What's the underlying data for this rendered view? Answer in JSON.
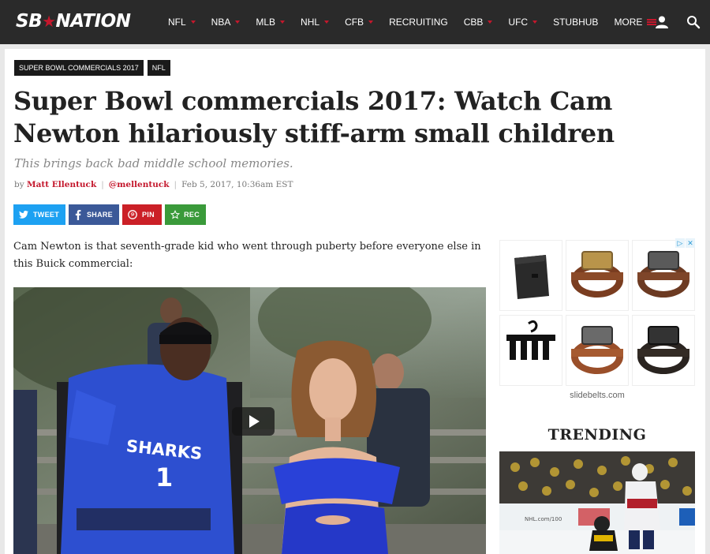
{
  "colors": {
    "nav_bg": "#2a2a2a",
    "accent": "#c4172c",
    "twitter": "#1da1f2",
    "facebook": "#3b5998",
    "pinterest": "#cb2027",
    "rec": "#3a9a3a"
  },
  "header": {
    "logo_left": "SB",
    "logo_star": "★",
    "logo_right": "NATION",
    "nav": [
      {
        "label": "NFL"
      },
      {
        "label": "NBA"
      },
      {
        "label": "MLB"
      },
      {
        "label": "NHL"
      },
      {
        "label": "CFB"
      },
      {
        "label": "RECRUITING"
      },
      {
        "label": "CBB"
      },
      {
        "label": "UFC"
      },
      {
        "label": "STUBHUB"
      },
      {
        "label": "MORE"
      }
    ],
    "icons": [
      "user-icon",
      "search-icon"
    ]
  },
  "article": {
    "tags": [
      "SUPER BOWL COMMERCIALS 2017",
      "NFL"
    ],
    "headline": "Super Bowl commercials 2017: Watch Cam Newton hilariously stiff-arm small children",
    "dek": "This brings back bad middle school memories.",
    "byline": {
      "prefix": "by",
      "author": "Matt Ellentuck",
      "handle": "@mellentuck",
      "date": "Feb 5, 2017, 10:36am EST"
    },
    "share": {
      "tweet": "TWEET",
      "share": "SHARE",
      "pin": "PIN",
      "rec": "REC"
    },
    "intro": "Cam Newton is that seventh-grade kid who went through puberty before everyone else in this Buick commercial:",
    "video": {
      "jersey_text": "SHARKS",
      "jersey_number": "1"
    }
  },
  "sidebar": {
    "ad": {
      "caption": "slidebelts.com",
      "badges": [
        "▷",
        "✕"
      ]
    },
    "trending_title": "TRENDING",
    "trending_image_board": "NHL.com/100"
  }
}
